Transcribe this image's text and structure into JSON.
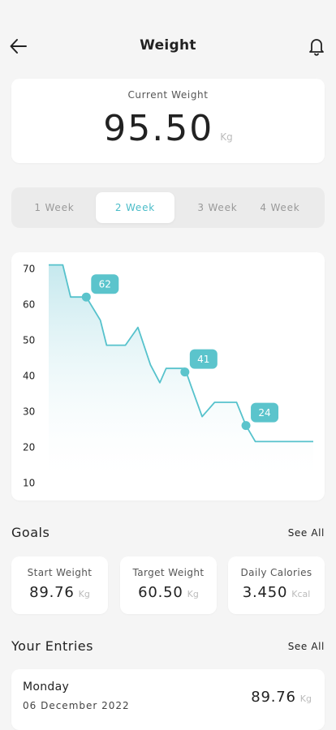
{
  "header": {
    "title": "Weight",
    "back_icon": "arrow-left-icon",
    "bell_icon": "bell-icon"
  },
  "current": {
    "label": "Current Weight",
    "value": "95.50",
    "unit": "Kg"
  },
  "tabs": [
    {
      "label": "1 Week",
      "active": false
    },
    {
      "label": "2 Week",
      "active": true
    },
    {
      "label": "3 Week",
      "active": false
    },
    {
      "label": "4 Week",
      "active": false
    }
  ],
  "chart_data": {
    "type": "line",
    "ylim": [
      10,
      70
    ],
    "yticks": [
      70,
      60,
      50,
      40,
      30,
      20,
      10
    ],
    "points": [
      [
        0,
        71
      ],
      [
        0.09,
        71
      ],
      [
        0.14,
        62
      ],
      [
        0.24,
        62
      ],
      [
        0.33,
        55.5
      ],
      [
        0.37,
        48.5
      ],
      [
        0.49,
        48.5
      ],
      [
        0.57,
        53.5
      ],
      [
        0.65,
        43
      ],
      [
        0.71,
        38
      ],
      [
        0.75,
        42
      ],
      [
        0.87,
        42
      ],
      [
        0.91,
        37
      ],
      [
        0.98,
        28.5
      ],
      [
        1.06,
        32.5
      ],
      [
        1.2,
        32.5
      ],
      [
        1.26,
        26
      ],
      [
        1.32,
        21.5
      ],
      [
        1.69,
        21.5
      ]
    ],
    "highlights": [
      {
        "x": 0.24,
        "y": 62,
        "label": "62"
      },
      {
        "x": 0.87,
        "y": 41,
        "label": "41"
      },
      {
        "x": 1.26,
        "y": 26,
        "label": "24"
      }
    ],
    "colors": {
      "line": "#56c2cc",
      "badge": "#5bc4cc",
      "fill_top": "#bfe6ec"
    }
  },
  "goals": {
    "title": "Goals",
    "see_all": "See All",
    "items": [
      {
        "label": "Start Weight",
        "value": "89.76",
        "unit": "Kg"
      },
      {
        "label": "Target Weight",
        "value": "60.50",
        "unit": "Kg"
      },
      {
        "label": "Daily Calories",
        "value": "3.450",
        "unit": "Kcal"
      }
    ]
  },
  "entries": {
    "title": "Your Entries",
    "see_all": "See All",
    "items": [
      {
        "day": "Monday",
        "date": "06 December 2022",
        "value": "89.76",
        "unit": "Kg"
      }
    ]
  }
}
